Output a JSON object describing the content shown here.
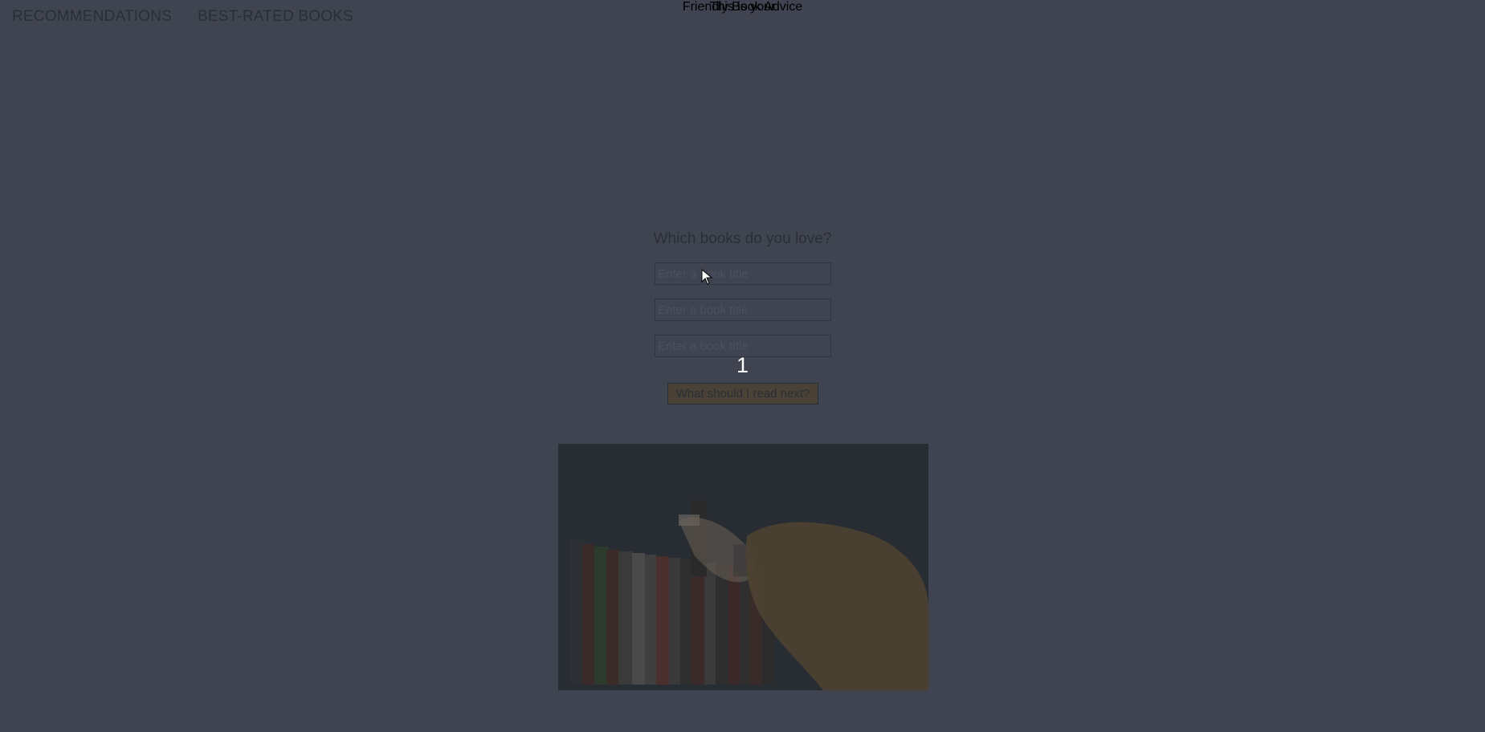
{
  "nav": {
    "items": [
      {
        "label": "RECOMMENDATIONS"
      },
      {
        "label": "BEST-RATED BOOKS"
      }
    ]
  },
  "hero": {
    "kicker": "This is your",
    "title": "Friendly Book Advice"
  },
  "form": {
    "question": "Which books do you love?",
    "inputs": [
      {
        "placeholder": "Enter a book title",
        "value": ""
      },
      {
        "placeholder": "Enter a book title",
        "value": ""
      },
      {
        "placeholder": "Enter a book title",
        "value": ""
      }
    ],
    "step_number": "1",
    "submit_label": "What should I read next?"
  },
  "colors": {
    "background": "#3f4450",
    "accent_title": "#4a3f33",
    "button_bg": "#4a4237",
    "step_number": "#ffffff"
  },
  "icons": {
    "cursor": "mouse-pointer-icon"
  },
  "image": {
    "semantic": "books-shelf-photo"
  }
}
